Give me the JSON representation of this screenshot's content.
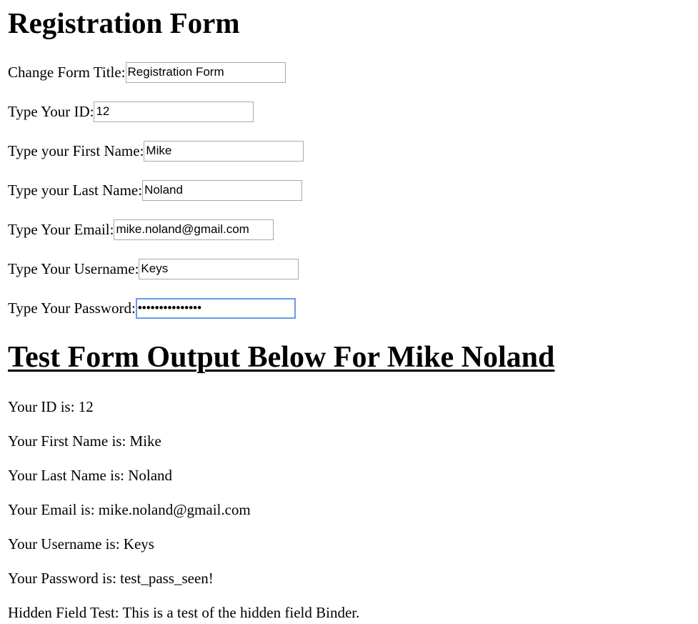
{
  "form": {
    "heading": "Registration Form",
    "fields": {
      "form_title": {
        "label": "Change Form Title:",
        "value": "Registration Form"
      },
      "id": {
        "label": "Type Your ID:",
        "value": "12"
      },
      "first_name": {
        "label": "Type your First Name:",
        "value": "Mike"
      },
      "last_name": {
        "label": "Type your Last Name:",
        "value": "Noland"
      },
      "email": {
        "label": "Type Your Email:",
        "value": "mike.noland@gmail.com"
      },
      "username": {
        "label": "Type Your Username:",
        "value": "Keys"
      },
      "password": {
        "label": "Type Your Password:",
        "value": "test_pass_seen!",
        "focused": true
      }
    }
  },
  "output": {
    "heading": "Test Form Output Below For Mike Noland",
    "lines": {
      "id": "Your ID is: 12",
      "first_name": "Your First Name is: Mike",
      "last_name": "Your Last Name is: Noland",
      "email": "Your Email is: mike.noland@gmail.com",
      "username": "Your Username is: Keys",
      "password": "Your Password is: test_pass_seen!",
      "hidden": "Hidden Field Test: This is a test of the hidden field Binder."
    }
  },
  "colors": {
    "field_border": "#a9a9a9",
    "focus_border": "#6a9ae6",
    "text": "#000000",
    "background": "#ffffff"
  }
}
